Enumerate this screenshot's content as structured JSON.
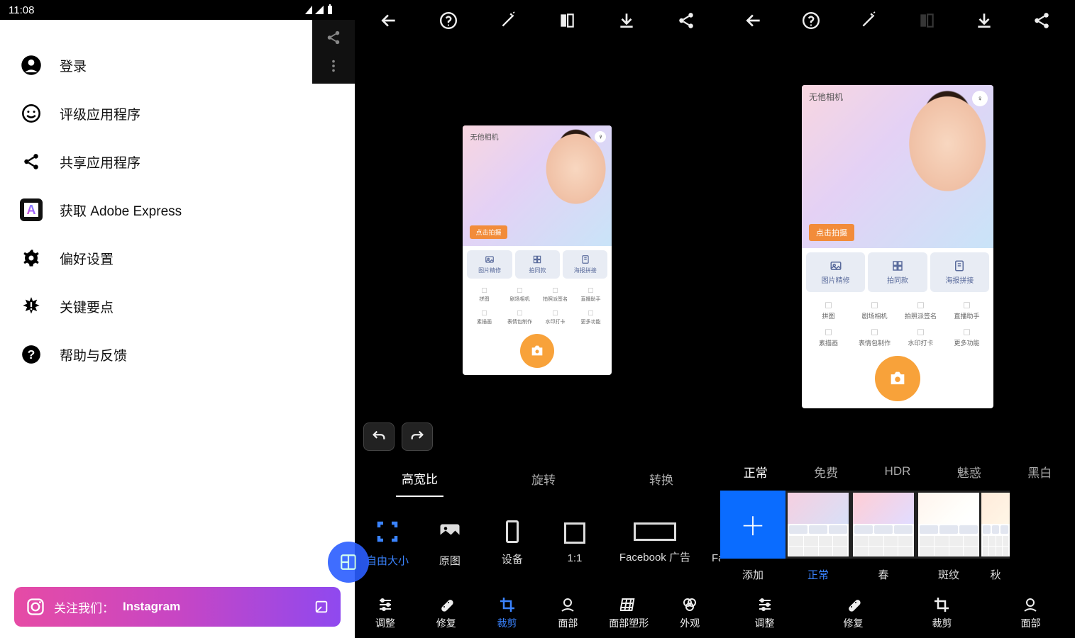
{
  "status_time": "11:08",
  "drawer": [
    {
      "icon": "user",
      "label": "登录"
    },
    {
      "icon": "smile",
      "label": "评级应用程序"
    },
    {
      "icon": "share",
      "label": "共享应用程序"
    },
    {
      "icon": "adobe",
      "label": "获取 Adobe Express"
    },
    {
      "icon": "gear",
      "label": "偏好设置"
    },
    {
      "icon": "burst",
      "label": "关键要点"
    },
    {
      "icon": "help",
      "label": "帮助与反馈"
    }
  ],
  "ig_banner": {
    "prefix": "关注我们：",
    "brand": "Instagram"
  },
  "mid": {
    "subtabs": [
      "高宽比",
      "旋转",
      "转换"
    ],
    "subtab_active": "高宽比",
    "ratios": [
      "自由大小",
      "原图",
      "设备",
      "1:1",
      "Facebook 广告",
      "Facebook"
    ],
    "ratio_active": "自由大小",
    "bottomnav": [
      "调整",
      "修复",
      "裁剪",
      "面部",
      "面部塑形",
      "外观"
    ],
    "bottomnav_active": "裁剪"
  },
  "right": {
    "subtabs": [
      "正常",
      "免费",
      "HDR",
      "魅惑",
      "黑白"
    ],
    "subtab_active": "正常",
    "looks": [
      "添加",
      "正常",
      "春",
      "斑纹",
      "秋"
    ],
    "look_active": "正常",
    "bottomnav": [
      "调整",
      "修复",
      "裁剪",
      "面部"
    ],
    "bottomnav_active": "外观"
  },
  "mock": {
    "brand": "无他相机",
    "cta": "点击拍摄",
    "row3": [
      "图片精修",
      "拍同款",
      "海报拼接"
    ],
    "grid": [
      "拼图",
      "剧场相机",
      "拍照派签名",
      "直播助手",
      "素描画",
      "表情包制作",
      "水印打卡",
      "更多功能"
    ]
  }
}
